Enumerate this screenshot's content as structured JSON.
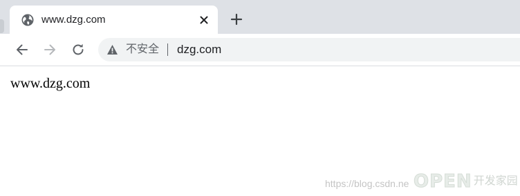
{
  "tab": {
    "title": "www.dzg.com",
    "icon": "globe-icon",
    "close_icon": "close-icon"
  },
  "new_tab": {
    "icon": "plus-icon"
  },
  "toolbar": {
    "back_icon": "arrow-left-icon",
    "forward_icon": "arrow-right-icon",
    "reload_icon": "reload-icon"
  },
  "omnibox": {
    "security_icon": "warning-triangle-icon",
    "security_label": "不安全",
    "url": "dzg.com"
  },
  "page": {
    "body_text": "www.dzg.com"
  },
  "watermark": {
    "url": "https://blog.csdn.ne",
    "logo_text": "OPEN",
    "logo_cn": "开发家园"
  },
  "colors": {
    "tabstrip": "#dee1e6",
    "omnibox": "#f1f3f4",
    "icon": "#5f6368",
    "text": "#202124"
  }
}
